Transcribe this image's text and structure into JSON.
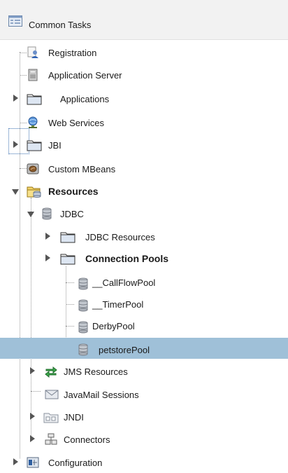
{
  "header": {
    "title": "Common Tasks"
  },
  "tree": {
    "registration": "Registration",
    "application_server": "Application Server",
    "applications": "Applications",
    "web_services": "Web Services",
    "jbi": "JBI",
    "custom_mbeans": "Custom MBeans",
    "resources": "Resources",
    "jdbc": "JDBC",
    "jdbc_resources": "JDBC Resources",
    "connection_pools": "Connection Pools",
    "callflowpool": "__CallFlowPool",
    "timerpool": "__TimerPool",
    "derbypool": "DerbyPool",
    "petstorepool": "petstorePool",
    "jms_resources": "JMS Resources",
    "javamail_sessions": "JavaMail Sessions",
    "jndi": "JNDI",
    "connectors": "Connectors",
    "configuration": "Configuration"
  },
  "colors": {
    "selection": "#9fc0d8",
    "header_bg": "#f2f2f2"
  }
}
